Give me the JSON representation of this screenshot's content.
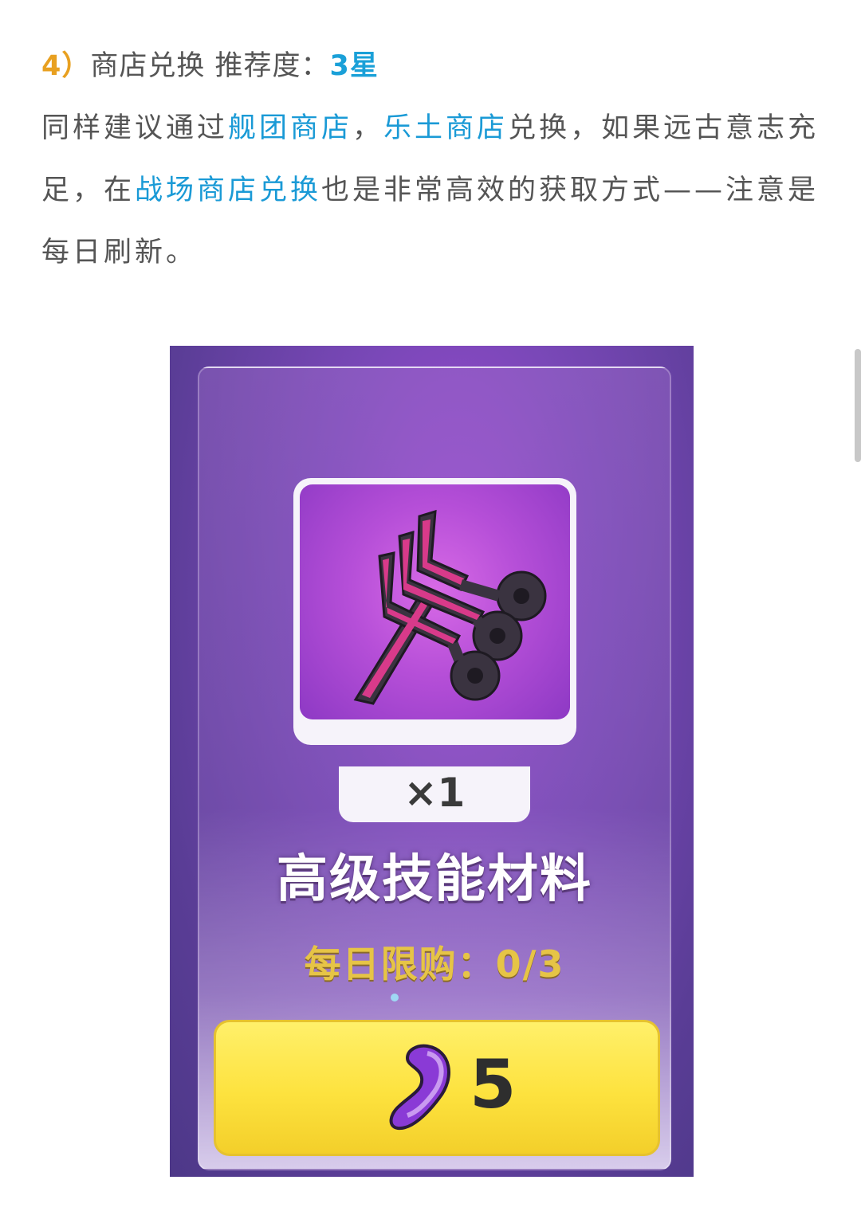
{
  "article": {
    "heading_number": "4）",
    "heading_title": "商店兑换 推荐度：",
    "heading_rating": "3星",
    "para_1": "同样建议通过",
    "link_1": "舰团商店",
    "para_2": "，",
    "link_2": "乐土商店",
    "para_3": "兑换，如果远古意志充足，在",
    "link_3": "战场商店兑换",
    "para_4": "也是非常高效的获取方式——注意是每日刷新。"
  },
  "shop_card": {
    "quantity": "×1",
    "item_name": "高级技能材料",
    "limit_text": "每日限购：0/3",
    "price": "5",
    "icon_item": "skill-material-icon",
    "icon_currency": "purple-crystal-icon"
  },
  "colors": {
    "accent_orange": "#e8a020",
    "accent_blue": "#1a9ad6",
    "button_yellow": "#fde23e"
  }
}
